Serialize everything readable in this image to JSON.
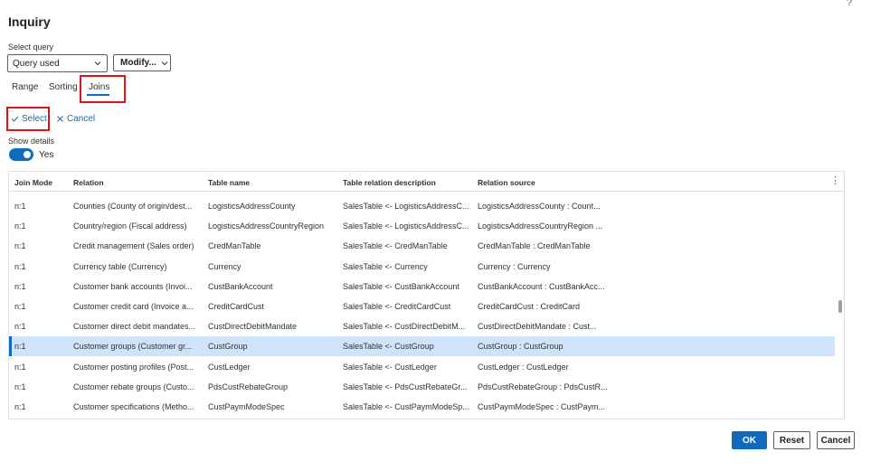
{
  "help_icon": "?",
  "title": "Inquiry",
  "select_query": {
    "label": "Select query",
    "value": "Query used",
    "icon": "chevron-down-icon"
  },
  "modify_button": {
    "label": "Modify...",
    "icon": "chevron-down-icon"
  },
  "tabs": [
    {
      "label": "Range",
      "active": false
    },
    {
      "label": "Sorting",
      "active": false
    },
    {
      "label": "Joins",
      "active": true
    }
  ],
  "actions": {
    "select": {
      "label": "Select",
      "icon": "checkmark-icon"
    },
    "cancel": {
      "label": "Cancel",
      "icon": "close-icon"
    }
  },
  "show_details": {
    "label": "Show details",
    "toggle_value": "Yes",
    "on": true
  },
  "grid": {
    "columns": [
      "Join Mode",
      "Relation",
      "Table name",
      "Table relation description",
      "Relation source"
    ],
    "more_icon": "more-vertical-icon",
    "rows": [
      [
        "n:1",
        "Counties  (County of origin/dest...",
        "LogisticsAddressCounty",
        "SalesTable <- LogisticsAddressC...",
        "LogisticsAddressCounty : Count..."
      ],
      [
        "n:1",
        "Country/region  (Fiscal address)",
        "LogisticsAddressCountryRegion",
        "SalesTable <- LogisticsAddressC...",
        "LogisticsAddressCountryRegion ..."
      ],
      [
        "n:1",
        "Credit management  (Sales order)",
        "CredManTable",
        "SalesTable <- CredManTable",
        "CredManTable : CredManTable"
      ],
      [
        "n:1",
        "Currency table  (Currency)",
        "Currency",
        "SalesTable <- Currency",
        "Currency : Currency"
      ],
      [
        "n:1",
        "Customer bank accounts  (Invoi...",
        "CustBankAccount",
        "SalesTable <- CustBankAccount",
        "CustBankAccount : CustBankAcc..."
      ],
      [
        "n:1",
        "Customer credit card  (Invoice a...",
        "CreditCardCust",
        "SalesTable <- CreditCardCust",
        "CreditCardCust : CreditCard"
      ],
      [
        "n:1",
        "Customer direct debit mandates...",
        "CustDirectDebitMandate",
        "SalesTable <- CustDirectDebitM...",
        "CustDirectDebitMandate : Cust..."
      ],
      [
        "n:1",
        "Customer groups  (Customer gr...",
        "CustGroup",
        "SalesTable <- CustGroup",
        "CustGroup : CustGroup"
      ],
      [
        "n:1",
        "Customer posting profiles  (Post...",
        "CustLedger",
        "SalesTable <- CustLedger",
        "CustLedger : CustLedger"
      ],
      [
        "n:1",
        "Customer rebate groups  (Custo...",
        "PdsCustRebateGroup",
        "SalesTable <- PdsCustRebateGr...",
        "PdsCustRebateGroup : PdsCustR..."
      ],
      [
        "n:1",
        "Customer specifications  (Metho...",
        "CustPaymModeSpec",
        "SalesTable <- CustPaymModeSp...",
        "CustPaymModeSpec : CustPaym..."
      ]
    ],
    "selected_row": 7
  },
  "footer": {
    "ok": "OK",
    "reset": "Reset",
    "cancel": "Cancel"
  },
  "colors": {
    "accent": "#0f6cbd",
    "selected_row": "#cfe4fa",
    "highlight_box": "#e3101c"
  }
}
